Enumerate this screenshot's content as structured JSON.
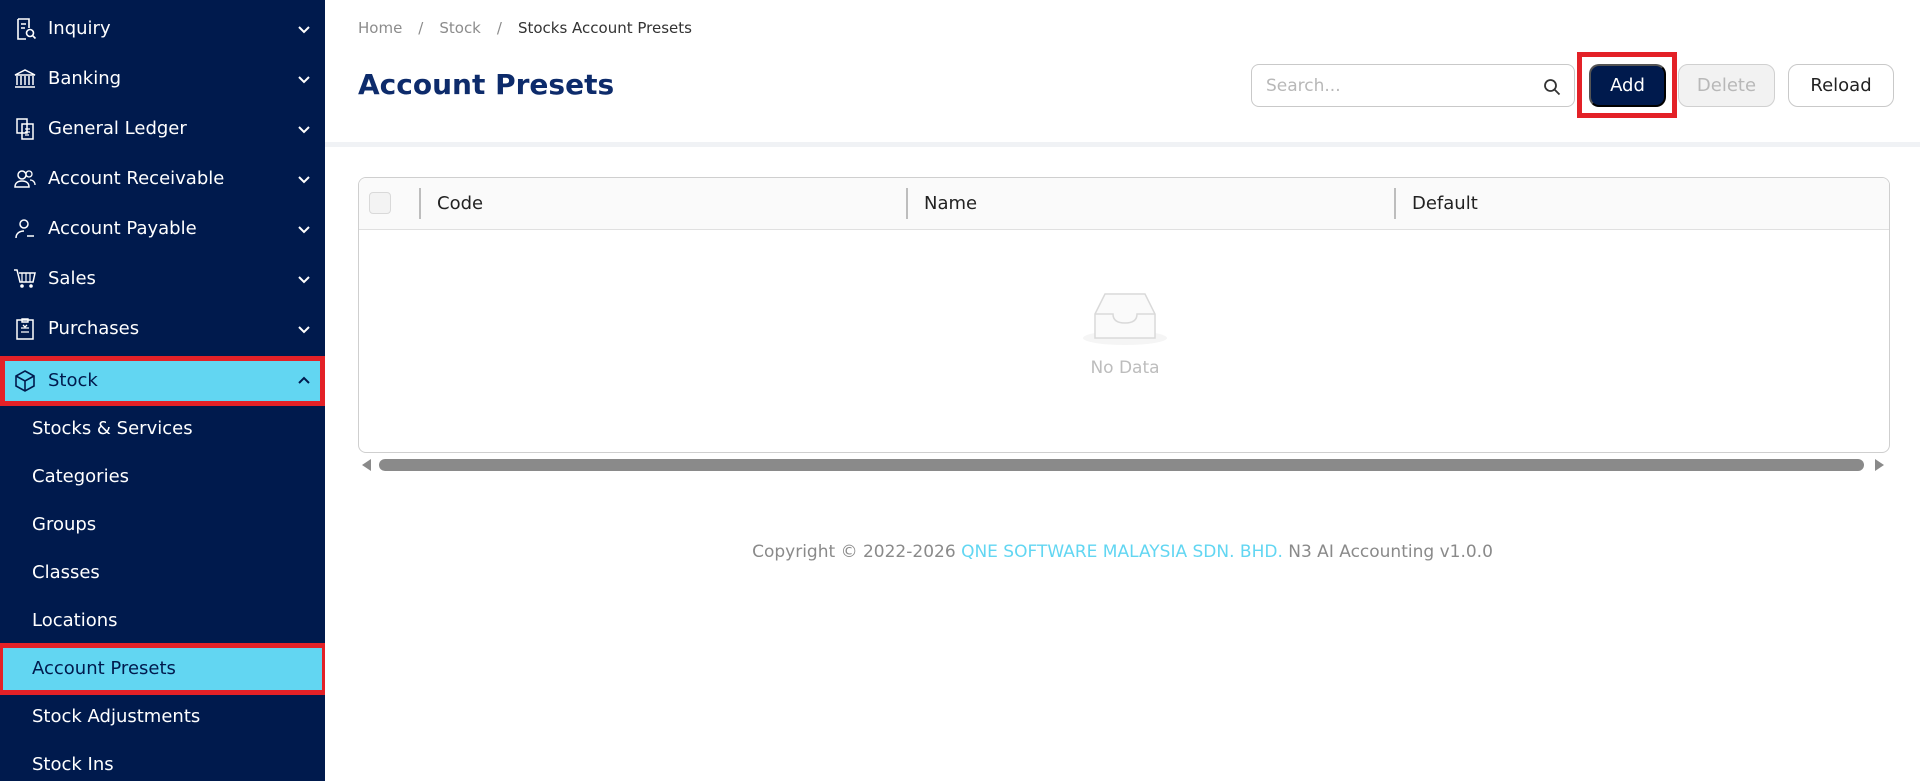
{
  "sidebar": {
    "items": [
      {
        "label": "Inquiry",
        "icon": "inquiry-icon"
      },
      {
        "label": "Banking",
        "icon": "bank-icon"
      },
      {
        "label": "General Ledger",
        "icon": "ledger-icon"
      },
      {
        "label": "Account Receivable",
        "icon": "users-icon"
      },
      {
        "label": "Account Payable",
        "icon": "user-icon"
      },
      {
        "label": "Sales",
        "icon": "cart-icon"
      },
      {
        "label": "Purchases",
        "icon": "clipboard-icon"
      },
      {
        "label": "Stock",
        "icon": "box-icon"
      }
    ],
    "sub_items": [
      {
        "label": "Stocks & Services"
      },
      {
        "label": "Categories"
      },
      {
        "label": "Groups"
      },
      {
        "label": "Classes"
      },
      {
        "label": "Locations"
      },
      {
        "label": "Account Presets"
      },
      {
        "label": "Stock Adjustments"
      },
      {
        "label": "Stock Ins"
      }
    ],
    "active_item": "Stock",
    "active_sub_item": "Account Presets"
  },
  "breadcrumb": {
    "items": [
      "Home",
      "Stock",
      "Stocks Account Presets"
    ],
    "separator": "/"
  },
  "page": {
    "title": "Account Presets"
  },
  "toolbar": {
    "search_placeholder": "Search...",
    "add_label": "Add",
    "delete_label": "Delete",
    "reload_label": "Reload"
  },
  "table": {
    "columns": [
      "Code",
      "Name",
      "Default"
    ],
    "empty_text": "No Data"
  },
  "footer": {
    "prefix": "Copyright",
    "symbol": "©",
    "years": "2022-2026",
    "company": "QNE SOFTWARE MALAYSIA SDN. BHD.",
    "product": "N3 AI Accounting v1.0.0"
  },
  "colors": {
    "sidebar_bg": "#001a4d",
    "active_bg": "#62d6f2",
    "highlight_border": "#e32127",
    "title": "#0d2b6b"
  }
}
